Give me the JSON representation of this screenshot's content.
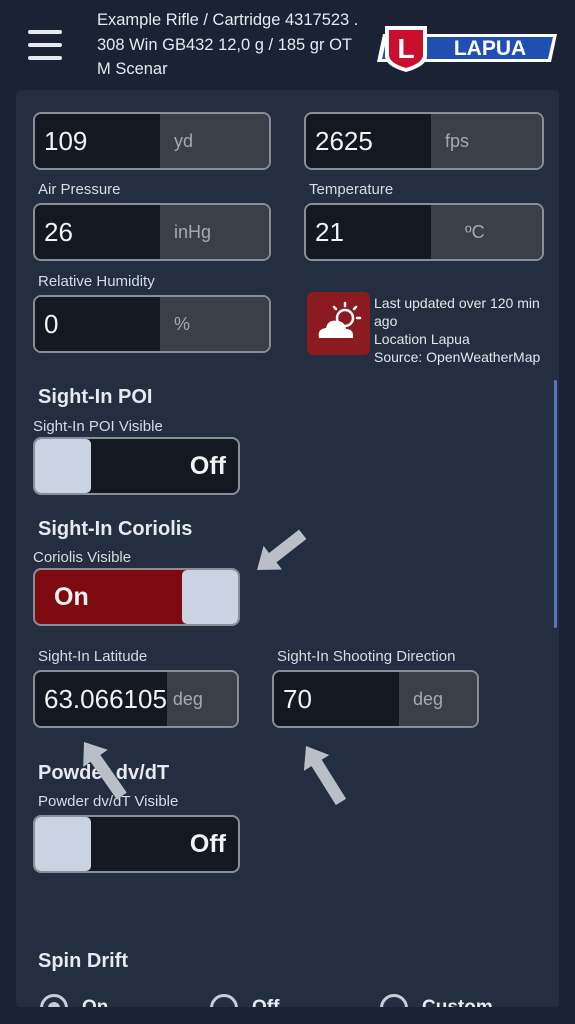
{
  "header": {
    "title": "Example Rifle / Cartridge 4317523 .308 Win GB432 12,0 g / 185 gr  OTM Scenar",
    "logo_text": "LAPUA",
    "logo_letter": "L"
  },
  "fields": {
    "range": {
      "value": "109",
      "unit": "yd"
    },
    "velocity": {
      "value": "2625",
      "unit": "fps"
    },
    "air_pressure": {
      "label": "Air Pressure",
      "value": "26",
      "unit": "inHg"
    },
    "temperature": {
      "label": "Temperature",
      "value": "21",
      "unit": "ºC"
    },
    "humidity": {
      "label": "Relative Humidity",
      "value": "0",
      "unit": "%"
    },
    "latitude": {
      "label": "Sight-In Latitude",
      "value": "63.066105",
      "unit": "deg"
    },
    "direction": {
      "label": "Sight-In Shooting Direction",
      "value": "70",
      "unit": "deg"
    }
  },
  "weather": {
    "line1": "Last updated over 120 min ago",
    "line2": "Location Lapua",
    "line3": "Source: OpenWeatherMap"
  },
  "sight_in_poi": {
    "title": "Sight-In POI",
    "label": "Sight-In POI Visible",
    "state": "Off"
  },
  "sight_in_coriolis": {
    "title": "Sight-In Coriolis",
    "label": "Coriolis Visible",
    "state": "On"
  },
  "powder": {
    "title": "Powder dv/dT",
    "label": "Powder dv/dT Visible",
    "state": "Off"
  },
  "spin_drift": {
    "title": "Spin Drift",
    "options": [
      "On",
      "Off",
      "Custom"
    ],
    "selected": "On"
  },
  "colors": {
    "background": "#1a2233",
    "panel": "#232e40",
    "accent_red": "#7d0a11",
    "toggle_knob": "#c9d3e2",
    "scrollbar": "#5a76b8"
  },
  "icons": [
    "menu-icon",
    "lapua-logo",
    "weather-partly-cloudy-icon",
    "pointer-arrow-icon"
  ]
}
